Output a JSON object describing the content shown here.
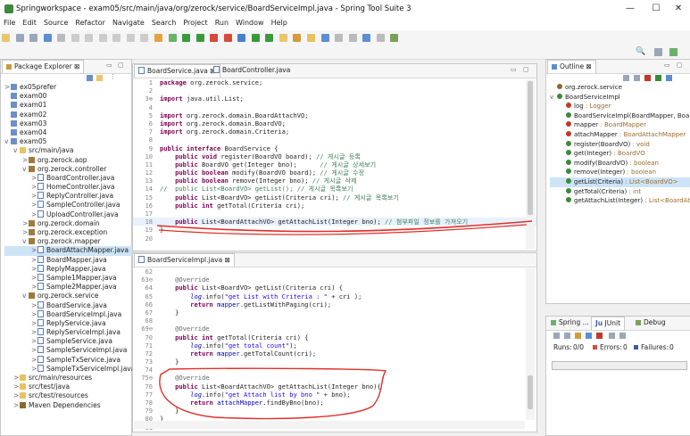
{
  "window": {
    "title": "Springworkspace - exam05/src/main/java/org/zerock/service/BoardServiceImpl.java - Spring Tool Suite 3",
    "minimize": "—",
    "maximize": "☐",
    "close": "✕"
  },
  "menu": [
    "File",
    "Edit",
    "Source",
    "Refactor",
    "Navigate",
    "Search",
    "Project",
    "Run",
    "Window",
    "Help"
  ],
  "package_explorer": {
    "tab_label": "Package Explorer",
    "tab_suffix": "⊠",
    "items": [
      {
        "label": "ex05prefer",
        "depth": 0,
        "icon": "proj",
        "arrow": ">"
      },
      {
        "label": "exam00",
        "depth": 0,
        "icon": "proj",
        "arrow": ""
      },
      {
        "label": "exam01",
        "depth": 0,
        "icon": "proj",
        "arrow": ""
      },
      {
        "label": "exam02",
        "depth": 0,
        "icon": "proj",
        "arrow": ""
      },
      {
        "label": "exam03",
        "depth": 0,
        "icon": "proj",
        "arrow": ""
      },
      {
        "label": "exam04",
        "depth": 0,
        "icon": "proj",
        "arrow": ""
      },
      {
        "label": "exam05",
        "depth": 0,
        "icon": "proj",
        "arrow": "v"
      },
      {
        "label": "src/main/java",
        "depth": 1,
        "icon": "folder",
        "arrow": "v"
      },
      {
        "label": "org.zerock.aop",
        "depth": 2,
        "icon": "pkg",
        "arrow": ">"
      },
      {
        "label": "org.zerock.controller",
        "depth": 2,
        "icon": "pkg",
        "arrow": "v"
      },
      {
        "label": "BoardController.java",
        "depth": 3,
        "icon": "jfile",
        "arrow": ">"
      },
      {
        "label": "HomeController.java",
        "depth": 3,
        "icon": "jfile",
        "arrow": ">"
      },
      {
        "label": "ReplyController.java",
        "depth": 3,
        "icon": "jfile",
        "arrow": ">"
      },
      {
        "label": "SampleController.java",
        "depth": 3,
        "icon": "jfile",
        "arrow": ">"
      },
      {
        "label": "UploadController.java",
        "depth": 3,
        "icon": "jfile",
        "arrow": ">"
      },
      {
        "label": "org.zerock.domain",
        "depth": 2,
        "icon": "pkg",
        "arrow": ">"
      },
      {
        "label": "org.zerock.exception",
        "depth": 2,
        "icon": "pkg",
        "arrow": ">"
      },
      {
        "label": "org.zerock.mapper",
        "depth": 2,
        "icon": "pkg",
        "arrow": "v"
      },
      {
        "label": "BoardAttachMapper.java",
        "depth": 3,
        "icon": "jfile",
        "arrow": ">",
        "selected": true
      },
      {
        "label": "BoardMapper.java",
        "depth": 3,
        "icon": "jfile",
        "arrow": ">"
      },
      {
        "label": "ReplyMapper.java",
        "depth": 3,
        "icon": "jfile",
        "arrow": ">"
      },
      {
        "label": "Sample1Mapper.java",
        "depth": 3,
        "icon": "jfile",
        "arrow": ">"
      },
      {
        "label": "Sample2Mapper.java",
        "depth": 3,
        "icon": "jfile",
        "arrow": ">"
      },
      {
        "label": "org.zerock.service",
        "depth": 2,
        "icon": "pkg",
        "arrow": "v"
      },
      {
        "label": "BoardService.java",
        "depth": 3,
        "icon": "jfile",
        "arrow": ">"
      },
      {
        "label": "BoardServiceImpl.java",
        "depth": 3,
        "icon": "jfile",
        "arrow": ">"
      },
      {
        "label": "ReplyService.java",
        "depth": 3,
        "icon": "jfile",
        "arrow": ">"
      },
      {
        "label": "ReplyServiceImpl.java",
        "depth": 3,
        "icon": "jfile",
        "arrow": ">"
      },
      {
        "label": "SampleService.java",
        "depth": 3,
        "icon": "jfile",
        "arrow": ">"
      },
      {
        "label": "SampleServiceImpl.java",
        "depth": 3,
        "icon": "jfile",
        "arrow": ">"
      },
      {
        "label": "SampleTxService.java",
        "depth": 3,
        "icon": "jfile",
        "arrow": ">"
      },
      {
        "label": "SampleTxServiceImpl.java",
        "depth": 3,
        "icon": "jfile",
        "arrow": ">"
      },
      {
        "label": "src/main/resources",
        "depth": 1,
        "icon": "folder",
        "arrow": ">"
      },
      {
        "label": "src/test/java",
        "depth": 1,
        "icon": "folder",
        "arrow": ">"
      },
      {
        "label": "src/test/resources",
        "depth": 1,
        "icon": "folder",
        "arrow": ">"
      },
      {
        "label": "Maven Dependencies",
        "depth": 1,
        "icon": "lib",
        "arrow": ">"
      }
    ]
  },
  "editor_top": {
    "tabs": [
      {
        "label": "BoardService.java",
        "close": "⊠",
        "active": true
      },
      {
        "label": "BoardController.java",
        "close": "",
        "active": false
      }
    ],
    "lines": [
      {
        "n": "1",
        "html": "<span class=\"kw\">package</span> org.zerock.service;"
      },
      {
        "n": "2",
        "html": ""
      },
      {
        "n": "3⊕",
        "html": "<span class=\"kw\">import</span> java.util.List;"
      },
      {
        "n": "4",
        "html": ""
      },
      {
        "n": "5",
        "html": "<span class=\"kw\">import</span> org.zerock.domain.BoardAttachVO;"
      },
      {
        "n": "6",
        "html": "<span class=\"kw\">import</span> org.zerock.domain.BoardVO;"
      },
      {
        "n": "7",
        "html": "<span class=\"kw\">import</span> org.zerock.domain.Criteria;"
      },
      {
        "n": "8",
        "html": ""
      },
      {
        "n": "9",
        "html": "<span class=\"kw\">public interface</span> BoardService {"
      },
      {
        "n": "10",
        "html": "    <span class=\"kw\">public void</span> register(BoardVO board); <span class=\"cm\">// 게시글 등록</span>"
      },
      {
        "n": "11",
        "html": "    <span class=\"kw\">public</span> BoardVO get(Integer bno);      <span class=\"cm\">// 게시글 상세보기</span>"
      },
      {
        "n": "12",
        "html": "    <span class=\"kw\">public boolean</span> modify(BoardVO board); <span class=\"cm\">// 게시글 수정</span>"
      },
      {
        "n": "13",
        "html": "    <span class=\"kw\">public boolean</span> remove(Integer bno); <span class=\"cm\">// 게시글 삭제</span>"
      },
      {
        "n": "14",
        "html": "<span class=\"cm\">//  public List&lt;BoardVO&gt; getList(); // 게시글 목록보기</span>"
      },
      {
        "n": "15",
        "html": "    <span class=\"kw\">public</span> List&lt;BoardVO&gt; getList(Criteria cri); <span class=\"cm\">// 게시글 목록보기</span>"
      },
      {
        "n": "16",
        "html": "    <span class=\"kw\">public int</span> getTotal(Criteria cri);"
      },
      {
        "n": "17",
        "html": ""
      },
      {
        "n": "18",
        "html": "    <span class=\"kw\">public</span> List&lt;BoardAttachVO&gt; getAttachList(Integer bno); <span class=\"cm\">// 첨부파일 정보를 가져오기</span>",
        "hl": true
      },
      {
        "n": "19",
        "html": "}"
      },
      {
        "n": "20",
        "html": ""
      }
    ]
  },
  "editor_bottom": {
    "tab_label": "BoardServiceImpl.java",
    "tab_close": "⊠",
    "lines": [
      {
        "n": "62",
        "html": ""
      },
      {
        "n": "63⊖",
        "html": "    <span class=\"ann\">@Override</span>"
      },
      {
        "n": "64",
        "html": "    <span class=\"kw\">public</span> List&lt;BoardVO&gt; getList(Criteria cri) {"
      },
      {
        "n": "65",
        "html": "        <span class=\"it\">log</span>.info(<span class=\"st\">\"get List with Criteria : \"</span> + cri );"
      },
      {
        "n": "66",
        "html": "        <span class=\"kw\">return</span> <span class=\"fd\">mapper</span>.getListWithPaging(cri);"
      },
      {
        "n": "67",
        "html": "    }"
      },
      {
        "n": "68",
        "html": ""
      },
      {
        "n": "69⊖",
        "html": "    <span class=\"ann\">@Override</span>"
      },
      {
        "n": "70",
        "html": "    <span class=\"kw\">public int</span> getTotal(Criteria cri) {"
      },
      {
        "n": "71",
        "html": "        <span class=\"it\">log</span>.info(<span class=\"st\">\"get total count\"</span>);"
      },
      {
        "n": "72",
        "html": "        <span class=\"kw\">return</span> <span class=\"fd\">mapper</span>.getTotalCount(cri);"
      },
      {
        "n": "73",
        "html": "    }"
      },
      {
        "n": "74",
        "html": ""
      },
      {
        "n": "75⊖",
        "html": "    <span class=\"ann\">@Override</span>"
      },
      {
        "n": "76",
        "html": "    <span class=\"kw\">public</span> List&lt;BoardAttachVO&gt; getAttachList(Integer bno){"
      },
      {
        "n": "77",
        "html": "        <span class=\"it\">log</span>.info(<span class=\"st\">\"get Attach list by bno \"</span> + bno);"
      },
      {
        "n": "78",
        "html": "        <span class=\"kw\">return</span> <span class=\"fd\">attachMapper</span>.findByBno(bno);"
      },
      {
        "n": "79",
        "html": "    }"
      },
      {
        "n": "80",
        "html": "}"
      },
      {
        "n": "81",
        "html": ""
      }
    ]
  },
  "outline": {
    "tab_label": "Outline",
    "tab_close": "⊠",
    "items": [
      {
        "label": "org.zerock.service",
        "detail": "",
        "depth": 0,
        "dot": "#8a6a2a"
      },
      {
        "label": "BoardServiceImpl",
        "detail": "",
        "depth": 0,
        "dot": "#3a8a3a",
        "arrow": "v"
      },
      {
        "label": "log",
        "detail": " : Logger",
        "depth": 1,
        "dot": "#c0392b"
      },
      {
        "label": "BoardServiceImpl(BoardMapper, Boa",
        "detail": "",
        "depth": 1,
        "dot": "#3a8a3a"
      },
      {
        "label": "mapper",
        "detail": " : BoardMapper",
        "depth": 1,
        "dot": "#c0392b"
      },
      {
        "label": "attachMapper",
        "detail": " : BoardAttachMapper",
        "depth": 1,
        "dot": "#c0392b"
      },
      {
        "label": "register(BoardVO)",
        "detail": " : void",
        "depth": 1,
        "dot": "#3a8a3a"
      },
      {
        "label": "get(Integer)",
        "detail": " : BoardVO",
        "depth": 1,
        "dot": "#3a8a3a"
      },
      {
        "label": "modify(BoardVO)",
        "detail": " : boolean",
        "depth": 1,
        "dot": "#3a8a3a"
      },
      {
        "label": "remove(Integer)",
        "detail": " : boolean",
        "depth": 1,
        "dot": "#3a8a3a"
      },
      {
        "label": "getList(Criteria)",
        "detail": " : List<BoardVO>",
        "depth": 1,
        "dot": "#3a8a3a",
        "selected": true
      },
      {
        "label": "getTotal(Criteria)",
        "detail": " : int",
        "depth": 1,
        "dot": "#3a8a3a"
      },
      {
        "label": "getAttachList(Integer)",
        "detail": " : List<BoardAt",
        "depth": 1,
        "dot": "#3a8a3a"
      }
    ]
  },
  "bottom_right": {
    "tabs": [
      "Spring ...",
      "JUnit",
      "Debug"
    ],
    "junit_prefix": "Ju",
    "runs_label": "Runs:",
    "runs_value": "0/0",
    "errors_label": "Errors:",
    "errors_value": "0",
    "failures_label": "Failures:",
    "failures_value": "0"
  },
  "colors": {
    "annotation_red": "#e0302a",
    "selection": "#cde4f7"
  }
}
